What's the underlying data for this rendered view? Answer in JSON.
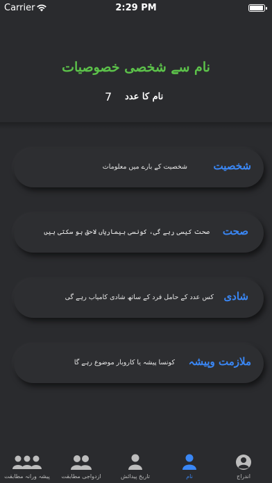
{
  "status": {
    "carrier": "Carrier",
    "time": "2:29 PM",
    "battery_level": 0.95
  },
  "header": {
    "title": "نام سے شخصی خصوصیات",
    "number_label": "نام کا عدد",
    "number_value": "7"
  },
  "cards": [
    {
      "title": "شخصیت",
      "subtitle": "شخصیت کے بارے میں معلومات"
    },
    {
      "title": "صحت",
      "subtitle": "صحت کیسی رہے گی، کونسی بیماریاں لاحق ہو سکتی ہیں"
    },
    {
      "title": "شادی",
      "subtitle": "کس عدد کے حامل فرد کے ساتھ شادی کامیاب رہے گی"
    },
    {
      "title": "ملازمت وپیشہ",
      "subtitle": "کونسا پیشہ یا کاروبار موضوع رہے گا"
    }
  ],
  "tabs": [
    {
      "label": "پیشہ ورانہ مطابقت",
      "icon": "group-icon"
    },
    {
      "label": "ازدواجی مطابقت",
      "icon": "couple-icon"
    },
    {
      "label": "تاریخ پیدائش",
      "icon": "person-icon"
    },
    {
      "label": "نام",
      "icon": "person-icon",
      "active": true
    },
    {
      "label": "اندراج",
      "icon": "profile-circle-icon"
    }
  ],
  "colors": {
    "accent": "#3a87f5",
    "title_green": "#5cc24a",
    "background": "#2a2b2e"
  }
}
